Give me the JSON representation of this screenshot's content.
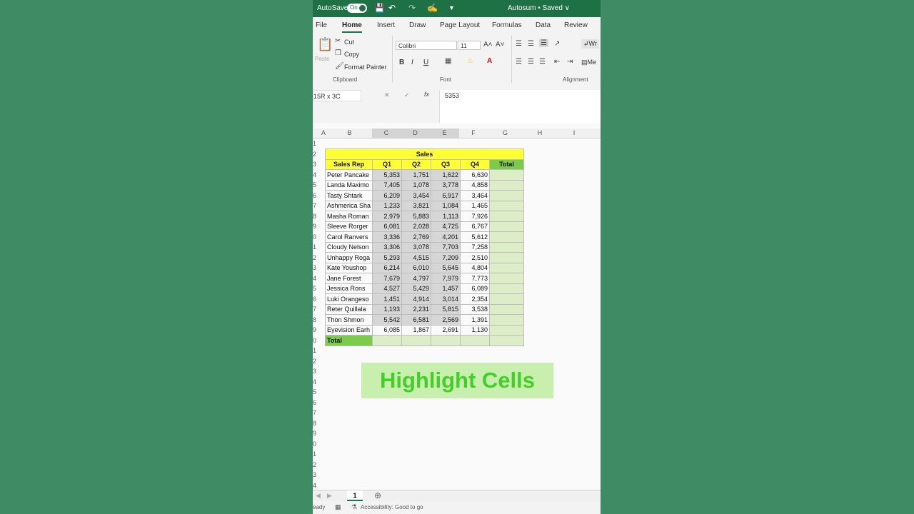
{
  "titlebar": {
    "autosave_label": "AutoSave",
    "autosave_state": "On",
    "doc_title": "Autosum • Saved ∨"
  },
  "tabs": [
    "File",
    "Home",
    "Insert",
    "Draw",
    "Page Layout",
    "Formulas",
    "Data",
    "Review"
  ],
  "active_tab": "Home",
  "ribbon": {
    "clipboard": {
      "paste": "Paste",
      "cut": "Cut",
      "copy": "Copy",
      "format_painter": "Format Painter",
      "label": "Clipboard"
    },
    "font": {
      "name": "Calibri",
      "size": "11",
      "bold": "B",
      "italic": "I",
      "underline": "U",
      "label": "Font"
    },
    "alignment": {
      "wrap": "Wr",
      "merge": "Me",
      "label": "Alignment"
    }
  },
  "formula_bar": {
    "name_box": "15R x 3C",
    "value": "5353"
  },
  "columns": [
    "A",
    "B",
    "C",
    "D",
    "E",
    "F",
    "G",
    "H",
    "I"
  ],
  "rows": [
    "1",
    "2",
    "3",
    "4",
    "5",
    "6",
    "7",
    "8",
    "9",
    "0",
    "1",
    "2",
    "3",
    "4",
    "5",
    "6",
    "7",
    "8",
    "9",
    "0",
    "1",
    "2",
    "3",
    "4",
    "5",
    "6",
    "7",
    "8",
    "9",
    "0",
    "1",
    "2",
    "3",
    "4"
  ],
  "table": {
    "title": "Sales",
    "headers": [
      "Sales Rep",
      "Q1",
      "Q2",
      "Q3",
      "Q4",
      "Total"
    ],
    "rows": [
      [
        "Peter Pancake",
        "5,353",
        "1,751",
        "1,622",
        "6,630"
      ],
      [
        "Landa Maximo",
        "7,405",
        "1,078",
        "3,778",
        "4,858"
      ],
      [
        "Tasty Shtark",
        "6,209",
        "3,454",
        "6,917",
        "3,464"
      ],
      [
        "Ashmerica Sha",
        "1,233",
        "3,821",
        "1,084",
        "1,465"
      ],
      [
        "Masha Roman",
        "2,979",
        "5,883",
        "1,113",
        "7,926"
      ],
      [
        "Sleeve Rorger",
        "6,081",
        "2,028",
        "4,725",
        "6,767"
      ],
      [
        "Carol Ranvers",
        "3,336",
        "2,769",
        "4,201",
        "5,612"
      ],
      [
        "Cloudy Nelson",
        "3,306",
        "3,078",
        "7,703",
        "7,258"
      ],
      [
        "Unhappy Roga",
        "5,293",
        "4,515",
        "7,209",
        "2,510"
      ],
      [
        "Kate Youshop",
        "6,214",
        "6,010",
        "5,645",
        "4,804"
      ],
      [
        "Jane Forest",
        "7,679",
        "4,797",
        "7,979",
        "7,773"
      ],
      [
        "Jessica Rons",
        "4,527",
        "5,429",
        "1,457",
        "6,089"
      ],
      [
        "Luki Orangeso",
        "1,451",
        "4,914",
        "3,014",
        "2,354"
      ],
      [
        "Reter Quillala",
        "1,193",
        "2,231",
        "5,815",
        "3,538"
      ],
      [
        "Thon Shmon",
        "5,542",
        "6,581",
        "2,569",
        "1,391"
      ],
      [
        "Eyevision Earh",
        "6,085",
        "1,867",
        "2,691",
        "1,130"
      ]
    ],
    "total_label": "Total"
  },
  "banner": "Highlight Cells",
  "sheet_tab": "1",
  "status": {
    "ready": "eady",
    "accessibility": "Accessibility: Good to go"
  }
}
